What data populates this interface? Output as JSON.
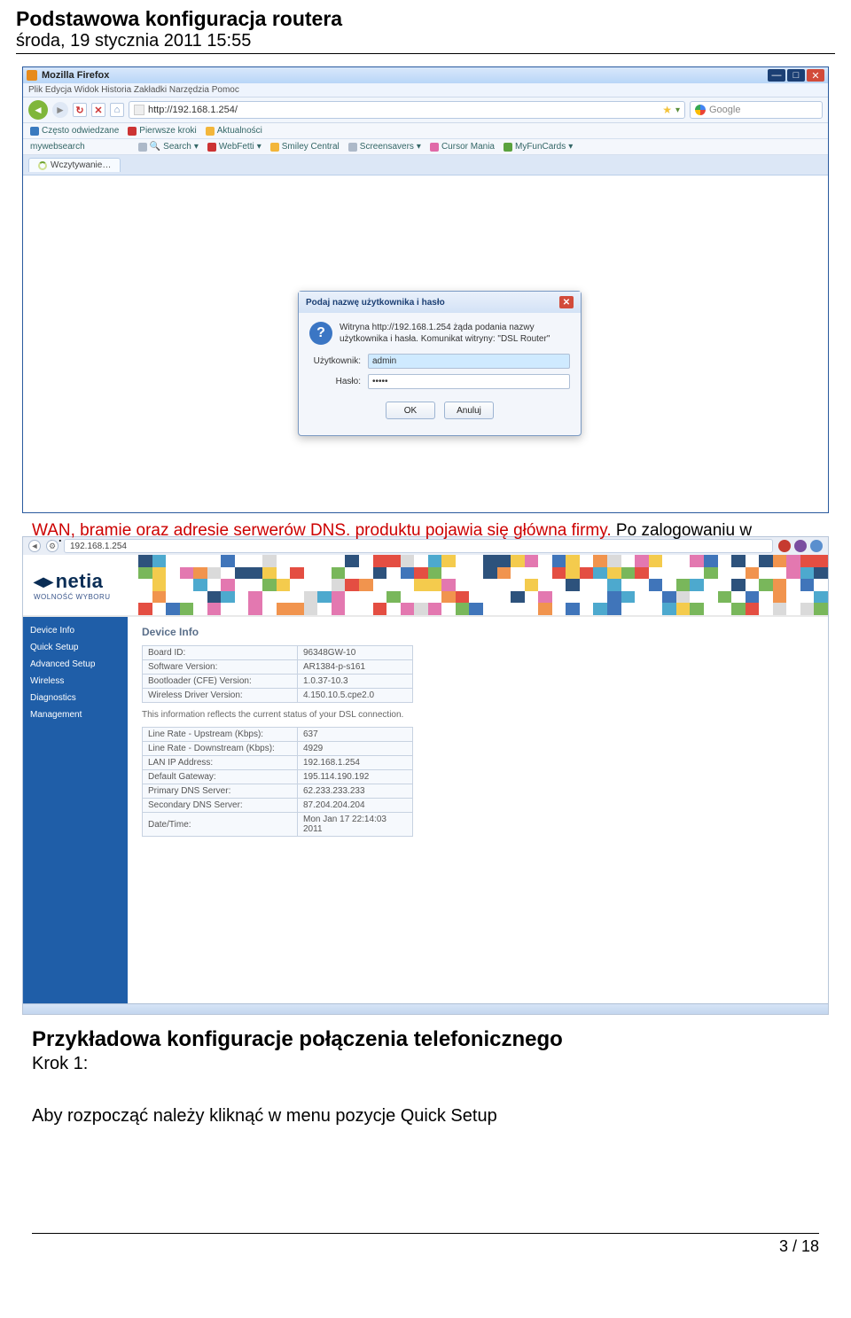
{
  "doc": {
    "title": "Podstawowa konfiguracja routera",
    "date": "środa, 19 stycznia 2011 15:55",
    "page": "3 / 18"
  },
  "garbled_line": "Po zalogowaniu w zakładce się ekran ta przedstawia informacje strona o wersji firmware, oraz o statusie portu",
  "garbled_red_prefix": "WAN, bramie oraz adresie serwerów DNS. produktu pojawia się główna firmy.",
  "firefox": {
    "window_title": "Mozilla Firefox",
    "menubar": "Plik  Edycja  Widok  Historia  Zakładki  Narzędzia  Pomoc",
    "url": "http://192.168.1.254/",
    "search_placeholder": "Google",
    "bookmarks": {
      "b0": "Często odwiedzane",
      "b1": "Pierwsze kroki",
      "b2": "Aktualności"
    },
    "toolbar2_brand": "mywebsearch",
    "toolbar2": {
      "t0": "Search",
      "t1": "WebFetti",
      "t2": "Smiley Central",
      "t3": "Screensavers",
      "t4": "Cursor Mania",
      "t5": "MyFunCards"
    },
    "tab_label": "Wczytywanie…"
  },
  "auth": {
    "title": "Podaj nazwę użytkownika i hasło",
    "message": "Witryna http://192.168.1.254 żąda podania nazwy użytkownika i hasła. Komunikat witryny: \"DSL Router\"",
    "label_user": "Użytkownik:",
    "label_pass": "Hasło:",
    "value_user": "admin",
    "value_pass": "•••••",
    "btn_ok": "OK",
    "btn_cancel": "Anuluj"
  },
  "router": {
    "address": "192.168.1.254",
    "brand": "netia",
    "brand_sub": "WOLNOŚĆ WYBORU",
    "menu": {
      "m0": "Device Info",
      "m1": "Quick Setup",
      "m2": "Advanced Setup",
      "m3": "Wireless",
      "m4": "Diagnostics",
      "m5": "Management"
    },
    "section_title": "Device Info",
    "note": "This information reflects the current status of your DSL connection.",
    "info_rows": [
      {
        "k": "Board ID:",
        "v": "96348GW-10"
      },
      {
        "k": "Software Version:",
        "v": "AR1384-p-s161"
      },
      {
        "k": "Bootloader (CFE) Version:",
        "v": "1.0.37-10.3"
      },
      {
        "k": "Wireless Driver Version:",
        "v": "4.150.10.5.cpe2.0"
      }
    ],
    "status_rows": [
      {
        "k": "Line Rate - Upstream (Kbps):",
        "v": "637"
      },
      {
        "k": "Line Rate - Downstream (Kbps):",
        "v": "4929"
      },
      {
        "k": "LAN IP Address:",
        "v": "192.168.1.254"
      },
      {
        "k": "Default Gateway:",
        "v": "195.114.190.192"
      },
      {
        "k": "Primary DNS Server:",
        "v": "62.233.233.233"
      },
      {
        "k": "Secondary DNS Server:",
        "v": "87.204.204.204"
      },
      {
        "k": "Date/Time:",
        "v": "Mon Jan 17 22:14:03 2011"
      }
    ]
  },
  "chart_data": {
    "type": "table",
    "title": "Device Info",
    "tables": [
      {
        "rows": [
          [
            "Board ID:",
            "96348GW-10"
          ],
          [
            "Software Version:",
            "AR1384-p-s161"
          ],
          [
            "Bootloader (CFE) Version:",
            "1.0.37-10.3"
          ],
          [
            "Wireless Driver Version:",
            "4.150.10.5.cpe2.0"
          ]
        ]
      },
      {
        "rows": [
          [
            "Line Rate - Upstream (Kbps):",
            "637"
          ],
          [
            "Line Rate - Downstream (Kbps):",
            "4929"
          ],
          [
            "LAN IP Address:",
            "192.168.1.254"
          ],
          [
            "Default Gateway:",
            "195.114.190.192"
          ],
          [
            "Primary DNS Server:",
            "62.233.233.233"
          ],
          [
            "Secondary DNS Server:",
            "87.204.204.204"
          ],
          [
            "Date/Time:",
            "Mon Jan 17 22:14:03 2011"
          ]
        ]
      }
    ]
  },
  "body": {
    "heading": "Przykładowa konfiguracje połączenia telefonicznego",
    "step": "Krok 1:",
    "para": "Aby rozpocząć należy kliknąć w menu pozycje Quick Setup"
  }
}
